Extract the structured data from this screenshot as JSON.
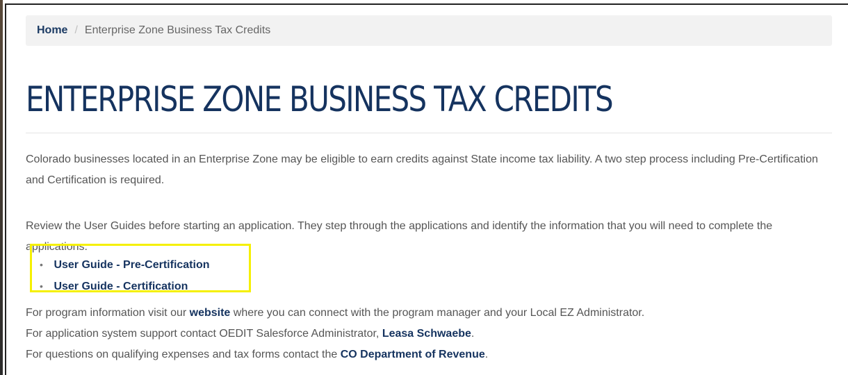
{
  "breadcrumb": {
    "home": "Home",
    "separator": "/",
    "current": "Enterprise Zone Business Tax Credits"
  },
  "page_title": "ENTERPRISE ZONE BUSINESS TAX CREDITS",
  "intro": "Colorado businesses located in an Enterprise Zone may be eligible to earn credits against State income tax liability. A two step process including Pre-Certification and Certification is required.",
  "guides_intro": "Review the User Guides before starting an application. They step through the applications and identify the information that you will need to complete the applications.",
  "guides": [
    {
      "label": "User Guide - Pre-Certification"
    },
    {
      "label": "User Guide - Certification"
    }
  ],
  "info": {
    "line1_prefix": "For program information visit our ",
    "line1_link": "website",
    "line1_suffix": " where you can connect with the program manager and your Local EZ Administrator.",
    "line2_prefix": "For application system support contact OEDIT Salesforce Administrator, ",
    "line2_link": "Leasa Schwaebe",
    "line2_suffix": ".",
    "line3_prefix": "For questions on qualifying expenses and tax forms contact the ",
    "line3_link": "CO Department of Revenue",
    "line3_suffix": "."
  },
  "colors": {
    "title": "#15335f",
    "link": "#15335f",
    "highlight": "#f5f000",
    "breadcrumb_bg": "#f2f2f2"
  }
}
